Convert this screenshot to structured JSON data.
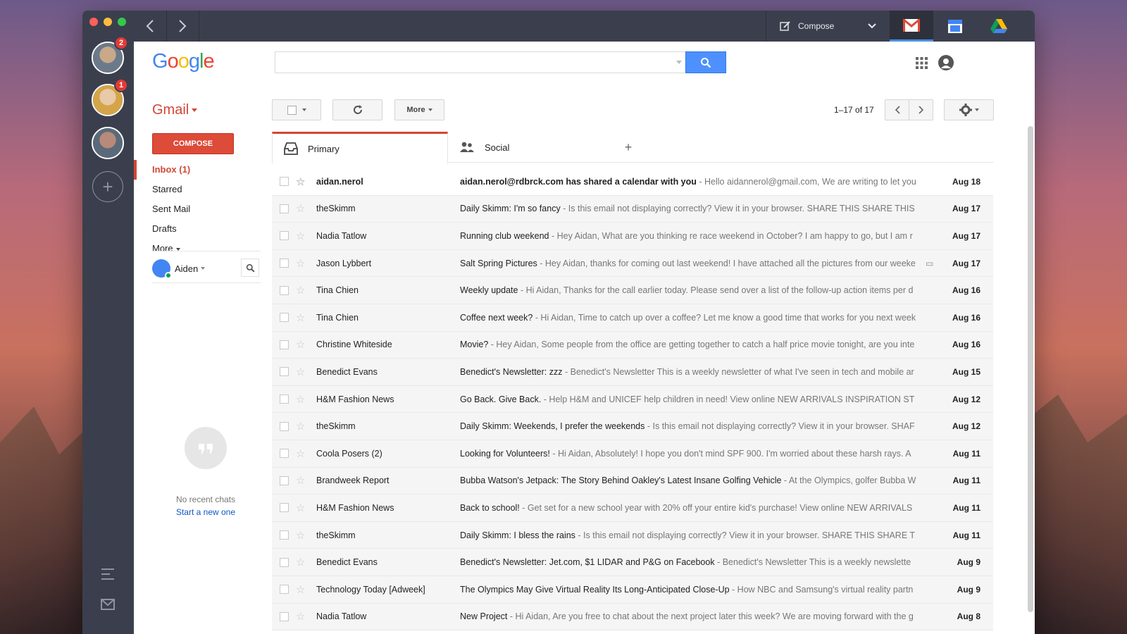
{
  "dock": {
    "avatars": [
      {
        "badge": "2",
        "colors": [
          "#6b7a8a",
          "#c9a88a"
        ]
      },
      {
        "badge": "1",
        "colors": [
          "#d4a548",
          "#e8c9a8"
        ]
      },
      {
        "badge": "",
        "colors": [
          "#5a6a7a",
          "#b88a7a"
        ]
      }
    ],
    "add_label": "+"
  },
  "titlebar": {
    "compose_label": "Compose"
  },
  "header": {
    "logo": [
      "G",
      "o",
      "o",
      "g",
      "l",
      "e"
    ],
    "logo_colors": [
      "#4285f4",
      "#ea4335",
      "#fbbc05",
      "#4285f4",
      "#34a853",
      "#ea4335"
    ],
    "search_value": "",
    "search_placeholder": ""
  },
  "gmail_label": "Gmail",
  "toolbar": {
    "more_label": "More",
    "pager": "1–17 of 17"
  },
  "compose_label": "COMPOSE",
  "nav": [
    {
      "label": "Inbox (1)",
      "active": true
    },
    {
      "label": "Starred",
      "active": false
    },
    {
      "label": "Sent Mail",
      "active": false
    },
    {
      "label": "Drafts",
      "active": false
    },
    {
      "label": "More",
      "active": false
    }
  ],
  "chat": {
    "user": "Aiden",
    "no_chats": "No recent chats",
    "start_new": "Start a new one"
  },
  "tabs": [
    {
      "label": "Primary",
      "icon": "inbox-icon"
    },
    {
      "label": "Social",
      "icon": "people-icon"
    }
  ],
  "emails": [
    {
      "sender": "aidan.nerol",
      "subject": "aidan.nerol@rdbrck.com has shared a calendar with you",
      "snippet": " - Hello aidannerol@gmail.com, We are writing to let you",
      "date": "Aug 18",
      "unread": true
    },
    {
      "sender": "theSkimm",
      "subject": "Daily Skimm: I'm so fancy",
      "snippet": " - Is this email not displaying correctly? View it in your browser. SHARE THIS SHARE THIS",
      "date": "Aug 17",
      "unread": false
    },
    {
      "sender": "Nadia Tatlow",
      "subject": "Running club weekend",
      "snippet": " - Hey Aidan, What are you thinking re race weekend in October? I am happy to go, but I am r",
      "date": "Aug 17",
      "unread": false
    },
    {
      "sender": "Jason Lybbert",
      "subject": "Salt Spring Pictures",
      "snippet": " - Hey Aidan, thanks for coming out last weekend! I have attached all the pictures from our weeke",
      "date": "Aug 17",
      "unread": false,
      "attachment": true
    },
    {
      "sender": "Tina Chien",
      "subject": "Weekly update",
      "snippet": " - Hi Aidan, Thanks for the call earlier today. Please send over a list of the follow-up action items per d",
      "date": "Aug 16",
      "unread": false
    },
    {
      "sender": "Tina Chien",
      "subject": "Coffee next week?",
      "snippet": " - Hi Aidan, Time to catch up over a coffee? Let me know a good time that works for you next week",
      "date": "Aug 16",
      "unread": false
    },
    {
      "sender": "Christine Whiteside",
      "subject": "Movie?",
      "snippet": " - Hey Aidan, Some people from the office are getting together to catch a half price movie tonight, are you inte",
      "date": "Aug 16",
      "unread": false
    },
    {
      "sender": "Benedict Evans",
      "subject": "Benedict's Newsletter: zzz",
      "snippet": " - Benedict's Newsletter This is a weekly newsletter of what I've seen in tech and mobile ar",
      "date": "Aug 15",
      "unread": false
    },
    {
      "sender": "H&M Fashion News",
      "subject": "Go Back. Give Back.",
      "snippet": " - Help H&M and UNICEF help children in need! View online NEW ARRIVALS INSPIRATION ST",
      "date": "Aug 12",
      "unread": false
    },
    {
      "sender": "theSkimm",
      "subject": "Daily Skimm: Weekends, I prefer the weekends",
      "snippet": " - Is this email not displaying correctly? View it in your browser. SHAF",
      "date": "Aug 12",
      "unread": false
    },
    {
      "sender": "Coola Posers (2)",
      "subject": "Looking for Volunteers!",
      "snippet": " - Hi Aidan, Absolutely! I hope you don't mind SPF 900. I'm worried about these harsh rays. A",
      "date": "Aug 11",
      "unread": false
    },
    {
      "sender": "Brandweek Report",
      "subject": "Bubba Watson's Jetpack: The Story Behind Oakley's Latest Insane Golfing Vehicle",
      "snippet": " - At the Olympics, golfer Bubba W",
      "date": "Aug 11",
      "unread": false
    },
    {
      "sender": "H&M Fashion News",
      "subject": "Back to school!",
      "snippet": " - Get set for a new school year with 20% off your entire kid's purchase! View online NEW ARRIVALS",
      "date": "Aug 11",
      "unread": false
    },
    {
      "sender": "theSkimm",
      "subject": "Daily Skimm: I bless the rains",
      "snippet": " - Is this email not displaying correctly? View it in your browser. SHARE THIS SHARE T",
      "date": "Aug 11",
      "unread": false
    },
    {
      "sender": "Benedict Evans",
      "subject": "Benedict's Newsletter: Jet.com, $1 LIDAR and P&G on Facebook",
      "snippet": " - Benedict's Newsletter This is a weekly newslette",
      "date": "Aug 9",
      "unread": false
    },
    {
      "sender": "Technology Today [Adweek]",
      "subject": "The Olympics May Give Virtual Reality Its Long-Anticipated Close-Up",
      "snippet": " - How NBC and Samsung's virtual reality partn",
      "date": "Aug 9",
      "unread": false
    },
    {
      "sender": "Nadia Tatlow",
      "subject": "New Project",
      "snippet": " - Hi Aidan, Are you free to chat about the next project later this week? We are moving forward with the g",
      "date": "Aug 8",
      "unread": false
    }
  ]
}
